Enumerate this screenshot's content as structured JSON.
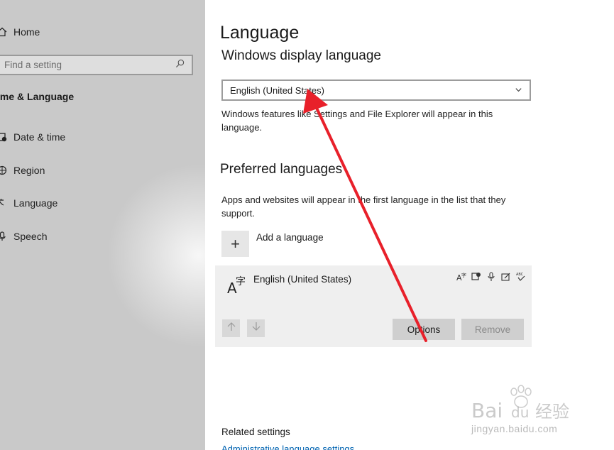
{
  "sidebar": {
    "home_label": "Home",
    "search_placeholder": "Find a setting",
    "section_title": "ime & Language",
    "items": [
      {
        "label": "Date & time",
        "icon": "date-time-icon"
      },
      {
        "label": "Region",
        "icon": "region-icon"
      },
      {
        "label": "Language",
        "icon": "language-icon"
      },
      {
        "label": "Speech",
        "icon": "speech-icon"
      }
    ]
  },
  "main": {
    "title": "Language",
    "display_language_heading": "Windows display language",
    "display_language_value": "English (United States)",
    "display_language_desc": "Windows features like Settings and File Explorer will appear in this language.",
    "preferred_heading": "Preferred languages",
    "preferred_desc": "Apps and websites will appear in the first language in the list that they support.",
    "add_language_label": "Add a language",
    "language_entry": {
      "name": "English (United States)",
      "feature_icons": [
        "language-pack-icon",
        "text-to-speech-icon",
        "speech-recognition-icon",
        "handwriting-icon",
        "spell-check-icon"
      ],
      "options_label": "Options",
      "remove_label": "Remove"
    },
    "related_heading": "Related settings",
    "admin_link": "Administrative language settings"
  },
  "colors": {
    "sidebar_bg": "#c9c9c9",
    "card_bg": "#efefef",
    "link": "#0063b1",
    "annotation_arrow": "#e8202a"
  },
  "watermark": {
    "brand": "Bai du 经验",
    "url": "jingyan.baidu.com"
  }
}
